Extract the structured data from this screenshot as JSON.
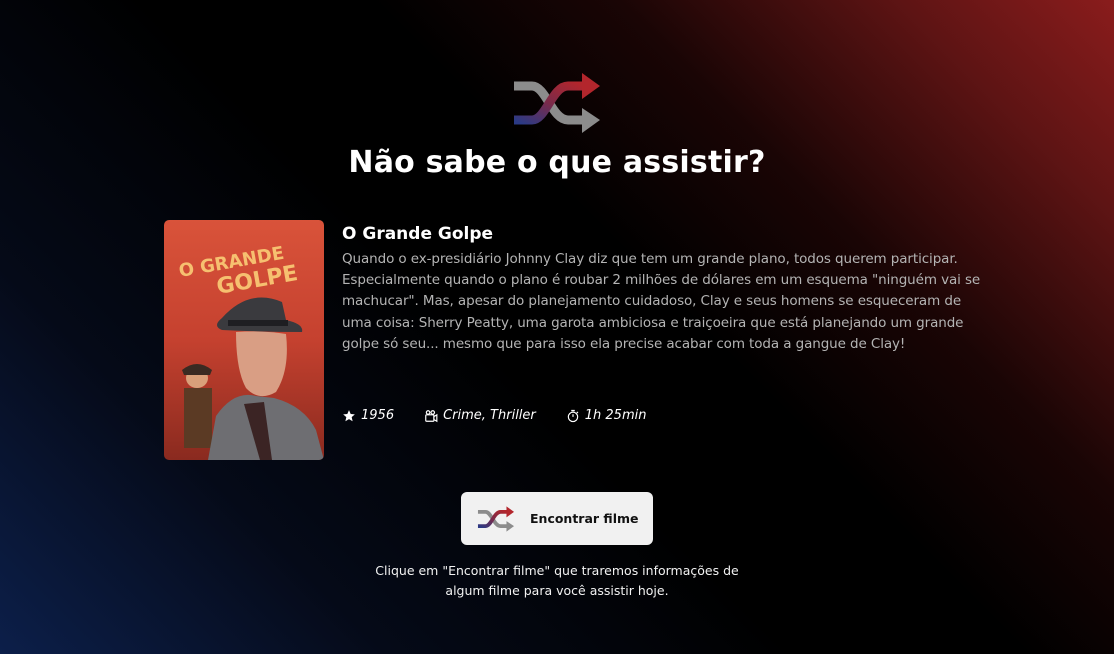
{
  "header": {
    "icon": "shuffle-icon",
    "title": "Não sabe o que assistir?"
  },
  "movie": {
    "poster_title_line1": "O GRANDE",
    "poster_title_line2": "GOLPE",
    "title": "O Grande Golpe",
    "synopsis": "Quando o ex-presidiário Johnny Clay diz que tem um grande plano, todos querem participar. Especialmente quando o plano é roubar 2 milhões de dólares em um esquema \"ninguém vai se machucar\". Mas, apesar do planejamento cuidadoso, Clay e seus homens se esqueceram de uma coisa: Sherry Peatty, uma garota ambiciosa e traiçoeira que está planejando um grande golpe só seu... mesmo que para isso ela precise acabar com toda a gangue de Clay!",
    "year": "1956",
    "genres": "Crime, Thriller",
    "duration": "1h 25min"
  },
  "action": {
    "button_label": "Encontrar filme",
    "hint": "Clique em \"Encontrar filme\" que traremos informações de algum filme para você assistir hoje."
  },
  "colors": {
    "accent_red": "#a8262c",
    "accent_blue": "#2b3a85",
    "icon_gray": "#8a8a8a",
    "button_bg": "#f1f1f1"
  }
}
